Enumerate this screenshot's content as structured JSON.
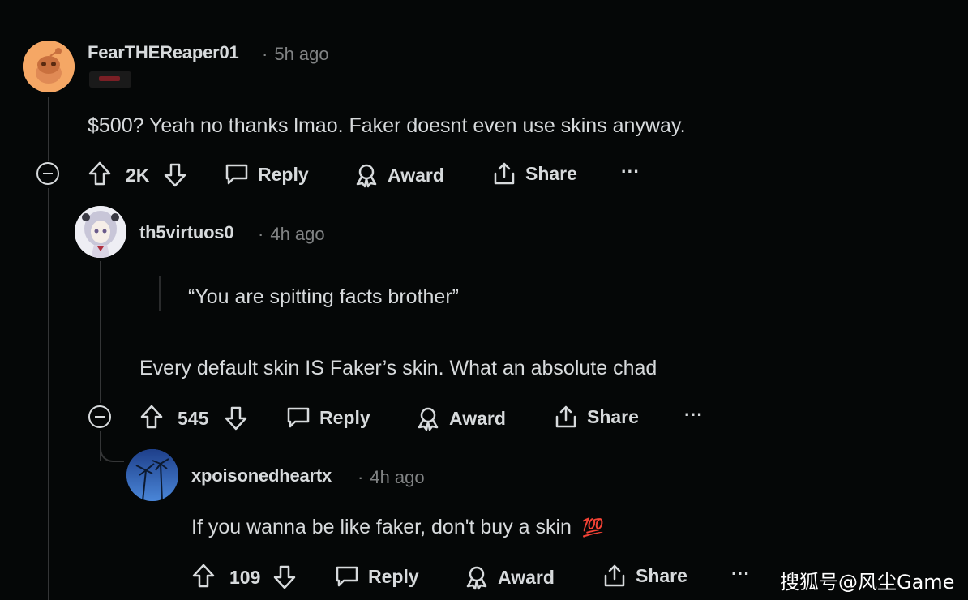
{
  "comments": [
    {
      "username": "FearTHEReaper01",
      "time": "5h ago",
      "text": "$500? Yeah no thanks lmao. Faker doesnt even use skins anyway.",
      "votes": "2K",
      "reply": "Reply",
      "award": "Award",
      "share": "Share",
      "more": "···"
    },
    {
      "username": "th5virtuos0",
      "time": "4h ago",
      "quote": "“You are spitting facts brother”",
      "text": "Every default skin IS Faker’s skin. What an absolute chad",
      "votes": "545",
      "reply": "Reply",
      "award": "Award",
      "share": "Share",
      "more": "···"
    },
    {
      "username": "xpoisonedheartx",
      "time": "4h ago",
      "text": "If you wanna be like faker, don't buy a skin",
      "emoji": "💯",
      "votes": "109",
      "reply": "Reply",
      "award": "Award",
      "share": "Share",
      "more": "···"
    }
  ],
  "watermark": "搜狐号@风尘Game",
  "colors": {
    "background": "#050707",
    "text": "#d7dadc",
    "muted": "#818384",
    "thread": "#343536"
  }
}
